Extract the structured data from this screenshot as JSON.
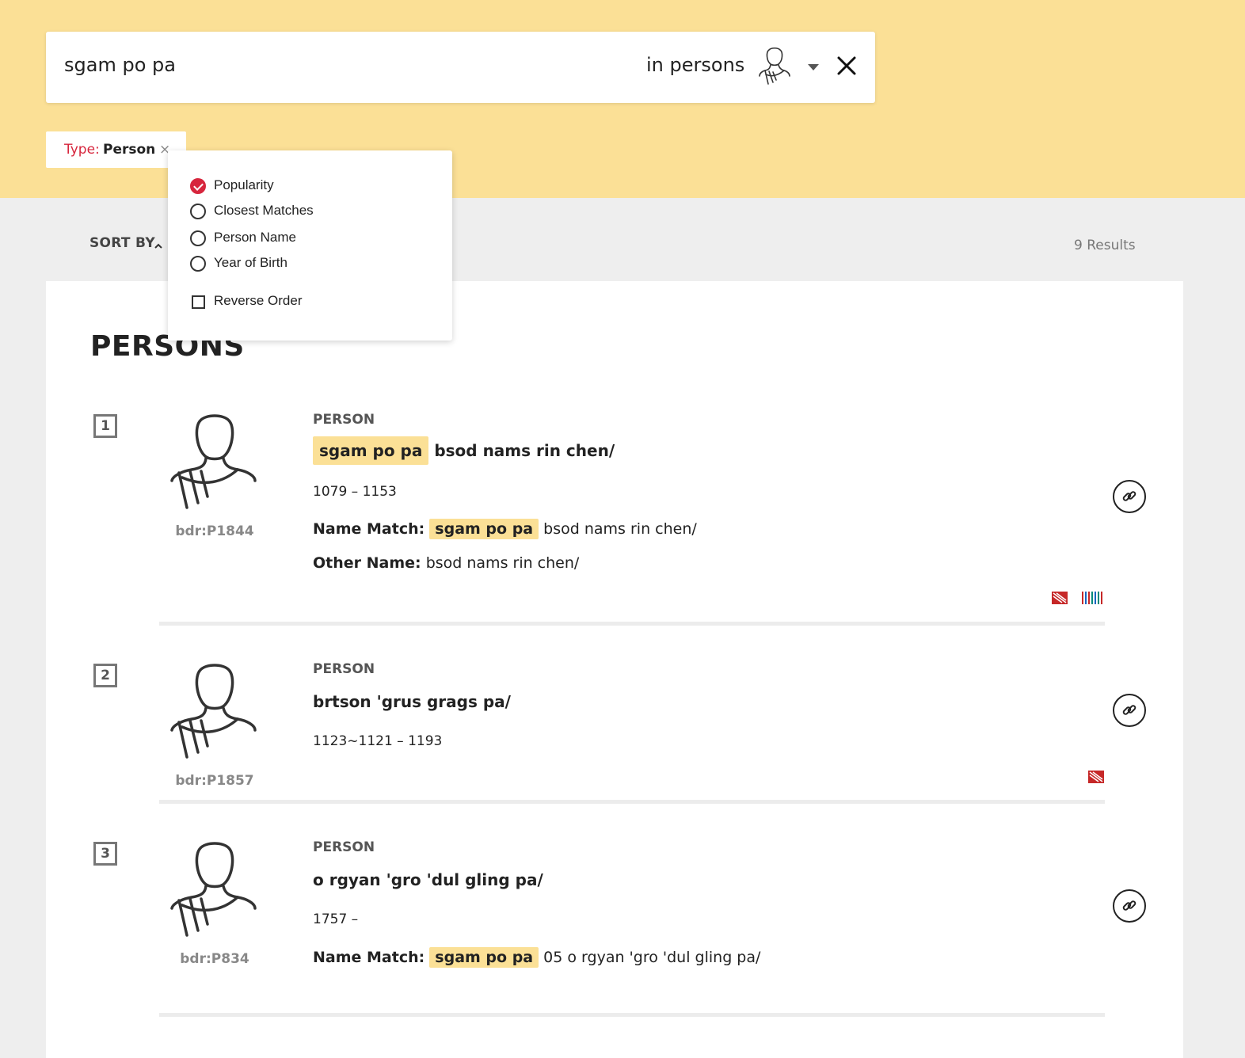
{
  "search": {
    "query": "sgam po pa",
    "scope": "in persons"
  },
  "filters": [
    {
      "key": "Type:",
      "value": "Person",
      "remove": "×"
    }
  ],
  "sort": {
    "label": "SORT BY",
    "options": [
      {
        "label": "Popularity",
        "selected": true
      },
      {
        "label": "Closest Matches",
        "selected": false
      },
      {
        "label": "Person Name",
        "selected": false
      },
      {
        "label": "Year of Birth",
        "selected": false
      }
    ],
    "reverse_label": "Reverse Order",
    "reverse_checked": false
  },
  "results_count": "9 Results",
  "section_title": "PERSONS",
  "results": [
    {
      "number": "1",
      "id": "bdr:P1844",
      "kind": "PERSON",
      "name_highlight": "sgam po pa",
      "name_rest": "bsod nams rin chen/",
      "dates": "1079 – 1153",
      "name_match_label": "Name Match:",
      "name_match_highlight": "sgam po pa",
      "name_match_rest": "bsod nams rin chen/",
      "other_name_label": "Other Name:",
      "other_name": "bsod nams rin chen/"
    },
    {
      "number": "2",
      "id": "bdr:P1857",
      "kind": "PERSON",
      "name": "brtson 'grus grags pa/",
      "dates": "1123~1121 – 1193"
    },
    {
      "number": "3",
      "id": "bdr:P834",
      "kind": "PERSON",
      "name": "o rgyan 'gro 'dul gling pa/",
      "dates": "1757 –",
      "name_match_label": "Name Match:",
      "name_match_highlight": "sgam po pa",
      "name_match_rest": "05 o rgyan 'gro 'dul gling pa/"
    }
  ],
  "icons": {
    "scope": "person-icon",
    "clear": "close-icon",
    "avatar": "person-avatar-icon",
    "link": "link-icon",
    "source_a": "source-red-icon",
    "source_b": "source-barcode-icon"
  },
  "colors": {
    "accent": "#d7263d",
    "highlight": "#fbe096",
    "banner": "#fbe096"
  }
}
